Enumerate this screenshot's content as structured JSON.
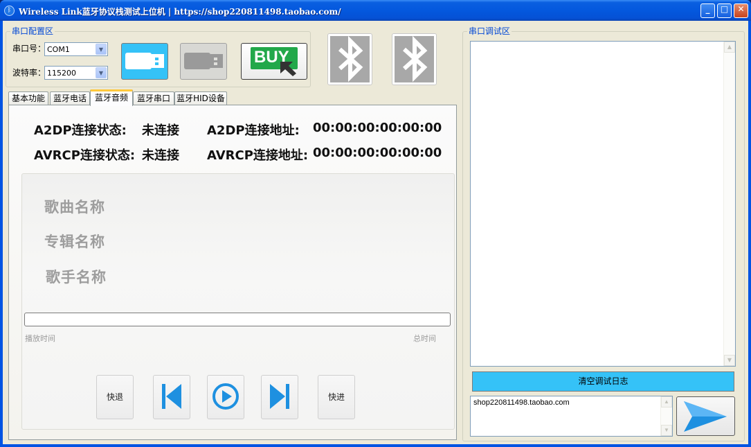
{
  "window": {
    "title": "Wireless Link蓝牙协议栈测试上位机 | https://shop220811498.taobao.com/",
    "minimize": "_",
    "maximize": "□",
    "close": "✕"
  },
  "serial_config": {
    "group_label": "串口配置区",
    "port_label": "串口号：",
    "port_value": "COM1",
    "baud_label": "波特率：",
    "baud_value": "115200",
    "buy_label": "BUY",
    "icons": [
      "usb-connect-icon",
      "usb-disconnect-icon",
      "buy-icon",
      "bluetooth-icon",
      "bluetooth-icon"
    ]
  },
  "tabs": [
    {
      "label": "基本功能"
    },
    {
      "label": "蓝牙电话"
    },
    {
      "label": "蓝牙音频",
      "active": true
    },
    {
      "label": "蓝牙串口"
    },
    {
      "label": "蓝牙HID设备"
    }
  ],
  "audio": {
    "a2dp_state_label": "A2DP连接状态:",
    "a2dp_state_value": "未连接",
    "a2dp_addr_label": "A2DP连接地址:",
    "a2dp_addr_value": "00:00:00:00:00:00",
    "avrcp_state_label": "AVRCP连接状态:",
    "avrcp_state_value": "未连接",
    "avrcp_addr_label": "AVRCP连接地址:",
    "avrcp_addr_value": "00:00:00:00:00:00",
    "song_label": "歌曲名称",
    "album_label": "专辑名称",
    "artist_label": "歌手名称",
    "progress": 0,
    "play_time_label": "播放时间",
    "total_time_label": "总时间",
    "rewind_label": "快退",
    "forward_label": "快进"
  },
  "debug": {
    "group_label": "串口调试区",
    "clear_label": "清空调试日志",
    "send_text": "shop220811498.taobao.com"
  },
  "colors": {
    "accent_blue": "#1e90e0",
    "clear_button": "#35c2f7",
    "buy_green": "#22a84a"
  }
}
